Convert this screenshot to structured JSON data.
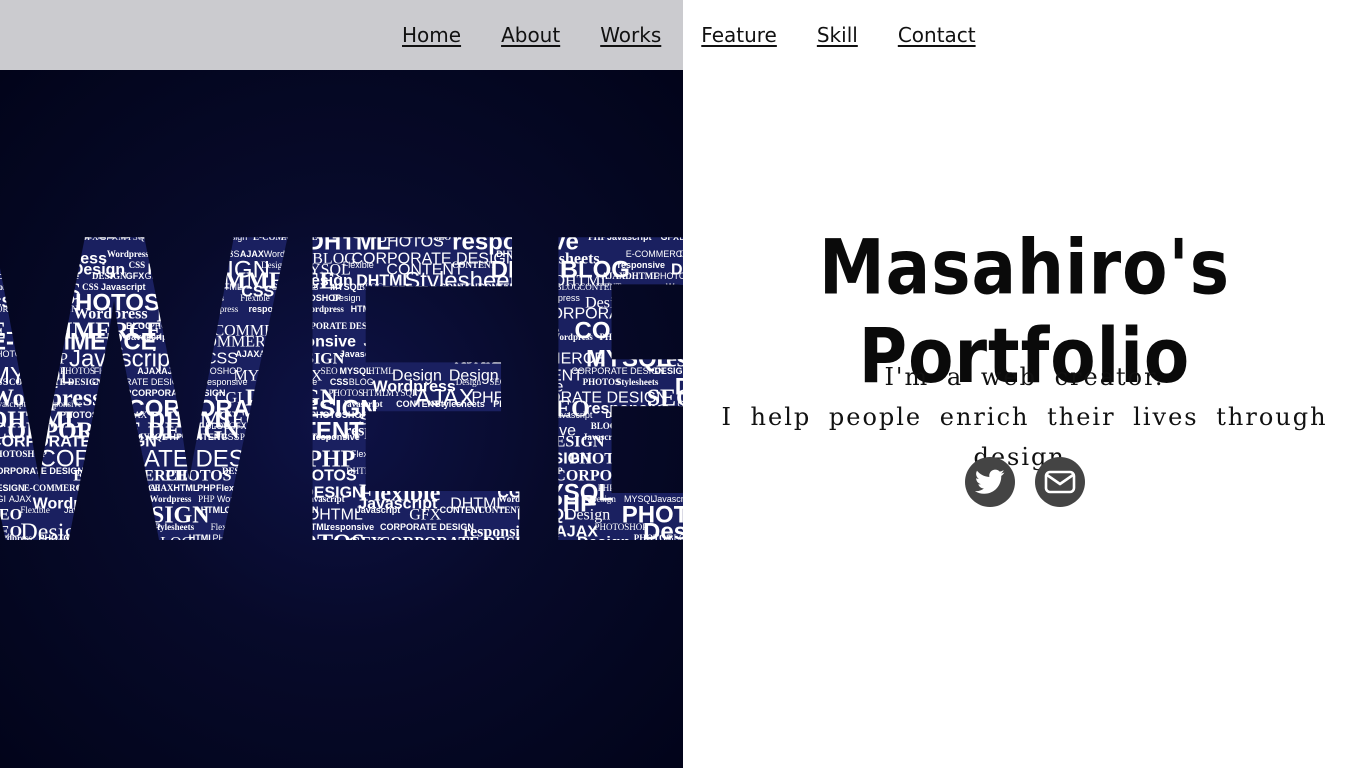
{
  "nav": {
    "items": [
      {
        "label": "Home"
      },
      {
        "label": "About"
      },
      {
        "label": "Works"
      },
      {
        "label": "Feature"
      },
      {
        "label": "Skill"
      },
      {
        "label": "Contact"
      }
    ]
  },
  "hero": {
    "image_words": [
      "HTML",
      "Design",
      "Wordpress",
      "PHOTOSHOP",
      "SEO",
      "CSS",
      "CONTENT",
      "BLOG",
      "CGI",
      "GFX",
      "DESIGN",
      "responsive",
      "Stylesheets",
      "Javascript",
      "PHP",
      "DHTML",
      "E-COMMERCE",
      "CORPORATE DESIGN",
      "Flexible",
      "MYSQL",
      "AJAX",
      "PHOTOS"
    ],
    "title": "Masahiro's Portfolio",
    "tagline_line1": "I'm a web creator.",
    "tagline_line2": "I help people enrich their lives through design."
  },
  "social": {
    "twitter_icon": "twitter-icon",
    "mail_icon": "mail-icon",
    "icon_bg_color": "#444444"
  },
  "colors": {
    "header_bg": "#cbcbcf",
    "hero_bg": "#070a2a",
    "text": "#111111"
  }
}
